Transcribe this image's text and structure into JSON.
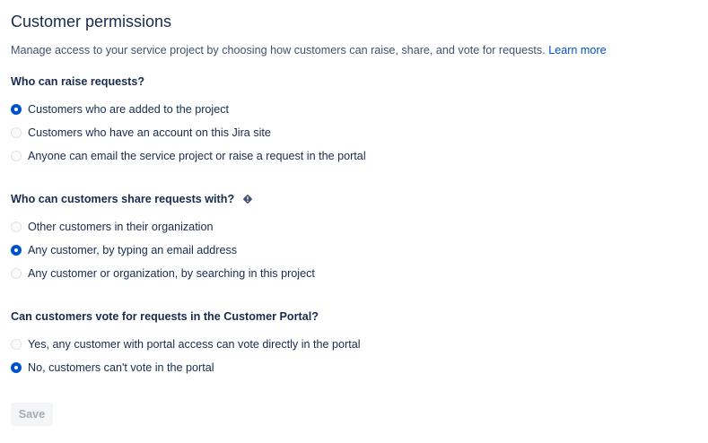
{
  "page": {
    "title": "Customer permissions",
    "description": "Manage access to your service project by choosing how customers can raise, share, and vote for requests.",
    "learn_more": "Learn more"
  },
  "sections": [
    {
      "heading": "Who can raise requests?",
      "options": [
        {
          "label": "Customers who are added to the project",
          "selected": true
        },
        {
          "label": "Customers who have an account on this Jira site",
          "selected": false
        },
        {
          "label": "Anyone can email the service project or raise a request in the portal",
          "selected": false
        }
      ]
    },
    {
      "heading": "Who can customers share requests with?",
      "heading_icon": "warning-diamond-icon",
      "options": [
        {
          "label": "Other customers in their organization",
          "selected": false
        },
        {
          "label": "Any customer, by typing an email address",
          "selected": true
        },
        {
          "label": "Any customer or organization, by searching in this project",
          "selected": false
        }
      ]
    },
    {
      "heading": "Can customers vote for requests in the Customer Portal?",
      "options": [
        {
          "label": "Yes, any customer with portal access can vote directly in the portal",
          "selected": false
        },
        {
          "label": "No, customers can't vote in the portal",
          "selected": true
        }
      ]
    }
  ],
  "save": {
    "label": "Save",
    "disabled": true
  },
  "colors": {
    "accent": "#0052cc",
    "text": "#172b4d",
    "subtle_text": "#42526e",
    "disabled_text": "#a5adba",
    "disabled_bg": "#f4f5f7",
    "radio_border": "#dfe1e6"
  }
}
